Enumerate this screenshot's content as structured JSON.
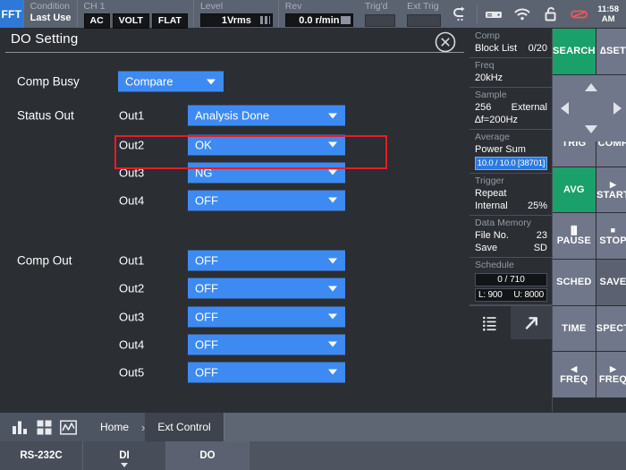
{
  "topbar": {
    "mode_tab": "FFT",
    "groups": [
      {
        "label": "Condition",
        "value": "Last Use"
      },
      {
        "label": "CH 1",
        "boxes": [
          "AC",
          "VOLT",
          "FLAT"
        ]
      },
      {
        "label": "Level",
        "value": "1Vrms"
      },
      {
        "label": "Rev",
        "value": "0.0 r/min"
      },
      {
        "label": "Trig'd",
        "value": ""
      },
      {
        "label": "Ext Trig",
        "value": ""
      }
    ],
    "icons": [
      "return-arrow-icon",
      "disk-drive-icon",
      "wifi-icon",
      "unlock-icon",
      "usb-memory-icon"
    ],
    "clock_time": "11:58",
    "clock_ampm": "AM"
  },
  "dialog": {
    "title": "DO Setting",
    "close_icon": "close-circle-icon",
    "comp_busy": {
      "label": "Comp Busy",
      "value": "Compare"
    },
    "status_out": {
      "label": "Status Out",
      "rows": [
        {
          "name": "Out1",
          "value": "Analysis Done",
          "highlighted": true
        },
        {
          "name": "Out2",
          "value": "OK"
        },
        {
          "name": "Out3",
          "value": "NG"
        },
        {
          "name": "Out4",
          "value": "OFF"
        }
      ]
    },
    "comp_out": {
      "label": "Comp Out",
      "rows": [
        {
          "name": "Out1",
          "value": "OFF"
        },
        {
          "name": "Out2",
          "value": "OFF"
        },
        {
          "name": "Out3",
          "value": "OFF"
        },
        {
          "name": "Out4",
          "value": "OFF"
        },
        {
          "name": "Out5",
          "value": "OFF"
        }
      ]
    }
  },
  "right_panel": {
    "info": [
      {
        "head": "Comp",
        "l1": "Block List",
        "r1": "0/20"
      },
      {
        "head": "Freq",
        "l1": "20kHz",
        "r1": ""
      },
      {
        "head": "Sample",
        "l1": "256",
        "r1": "External",
        "l2": "∆f=200Hz",
        "r2": ""
      },
      {
        "head": "Average",
        "l1": "Power Sum",
        "r1": "",
        "bar": "10.0 / 10.0 [38701]"
      },
      {
        "head": "Trigger",
        "l1": "Repeat",
        "r1": "",
        "l2": "Internal",
        "r2": "25%"
      },
      {
        "head": "Data Memory",
        "l1": "File No.",
        "r1": "23",
        "l2": "Save",
        "r2": "SD"
      },
      {
        "head": "Schedule",
        "dark1": "0 / 710",
        "dark2_l": "L: 900",
        "dark2_r": "U: 8000"
      }
    ],
    "bottom_icons": [
      "list-icon",
      "expand-arrow-icon"
    ],
    "keys": [
      {
        "label": "SEARCH",
        "style": "green"
      },
      {
        "label": "∆SET",
        "style": "plain"
      },
      {
        "label": "TRIG",
        "style": "plain"
      },
      {
        "label": "COMP",
        "style": "plain"
      },
      {
        "label": "AVG",
        "style": "green"
      },
      {
        "label": "START",
        "style": "plain",
        "sub": "▶"
      },
      {
        "label": "PAUSE",
        "style": "plain",
        "sub": "▐▌"
      },
      {
        "label": "STOP",
        "style": "plain",
        "sub": "■"
      },
      {
        "label": "SCHED",
        "style": "plain"
      },
      {
        "label": "SAVE",
        "style": "dark"
      },
      {
        "label": "TIME",
        "style": "plain"
      },
      {
        "label": "SPECT",
        "style": "plain"
      },
      {
        "label": "FREQ",
        "style": "plain",
        "sub": "◀"
      },
      {
        "label": "FREQ",
        "style": "plain",
        "sub": "▶"
      }
    ]
  },
  "breadcrumb": {
    "icons": [
      "bar-chart-icon",
      "grid-icon",
      "waveform-icon"
    ],
    "home": "Home",
    "separator": "›",
    "current": "Ext Control"
  },
  "tabbar": {
    "tabs": [
      {
        "label": "RS-232C",
        "selected": false,
        "chevron": false
      },
      {
        "label": "DI",
        "selected": false,
        "chevron": true
      },
      {
        "label": "DO",
        "selected": true,
        "chevron": false
      }
    ]
  },
  "colors": {
    "accent_blue": "#3d8bf2",
    "highlight_red": "#ee1b24",
    "key_green": "#1aa06a",
    "topbar_gray": "#5b6270",
    "panel_bg": "#2b2e33"
  }
}
